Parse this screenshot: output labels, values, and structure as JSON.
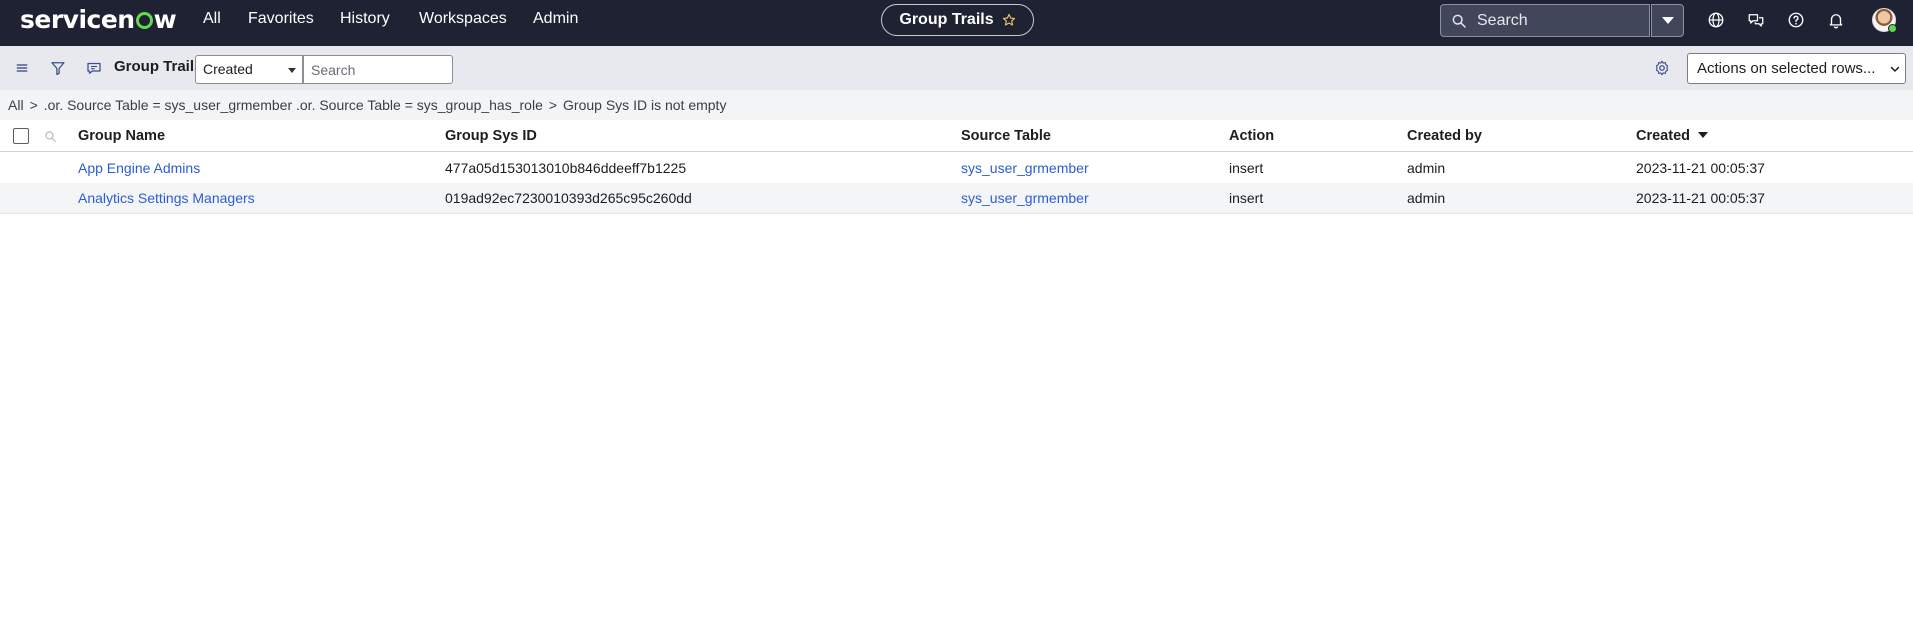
{
  "topnav": {
    "logo_pre": "servicen",
    "logo_post": "w",
    "items": [
      "All",
      "Favorites",
      "History",
      "Workspaces",
      "Admin"
    ],
    "context_title": "Group Trails",
    "search_placeholder": "Search"
  },
  "toolbar": {
    "title": "Group Trails",
    "field_select_value": "Created",
    "search_placeholder": "Search",
    "actions_label": "Actions on selected rows..."
  },
  "breadcrumb": {
    "root": "All",
    "separator": ">",
    "conditions": [
      ".or. Source Table = sys_user_grmember .or. Source Table = sys_group_has_role",
      "Group Sys ID is not empty"
    ]
  },
  "table": {
    "columns": [
      "Group Name",
      "Group Sys ID",
      "Source Table",
      "Action",
      "Created by",
      "Created"
    ],
    "rows": [
      {
        "group_name": "App Engine Admins",
        "group_sys_id": "477a05d153013010b846ddeeff7b1225",
        "source_table": "sys_user_grmember",
        "action": "insert",
        "created_by": "admin",
        "created": "2023-11-21 00:05:37"
      },
      {
        "group_name": "Analytics Settings Managers",
        "group_sys_id": "019ad92ec7230010393d265c95c260dd",
        "source_table": "sys_user_grmember",
        "action": "insert",
        "created_by": "admin",
        "created": "2023-11-21 00:05:37"
      }
    ]
  },
  "colors": {
    "nav_bg": "#1f2233",
    "logo_accent": "#62d84e",
    "link": "#2b5dd3",
    "toolbar_bg": "#e8e9ee"
  },
  "icons": {
    "context_favorite": "star-icon",
    "globe": "globe-icon",
    "chat": "chat-icon",
    "help": "help-icon",
    "notifications": "bell-icon",
    "list_menu": "hamburger-icon",
    "filter": "filter-icon",
    "comments": "comment-icon",
    "personalize": "gear-icon"
  }
}
